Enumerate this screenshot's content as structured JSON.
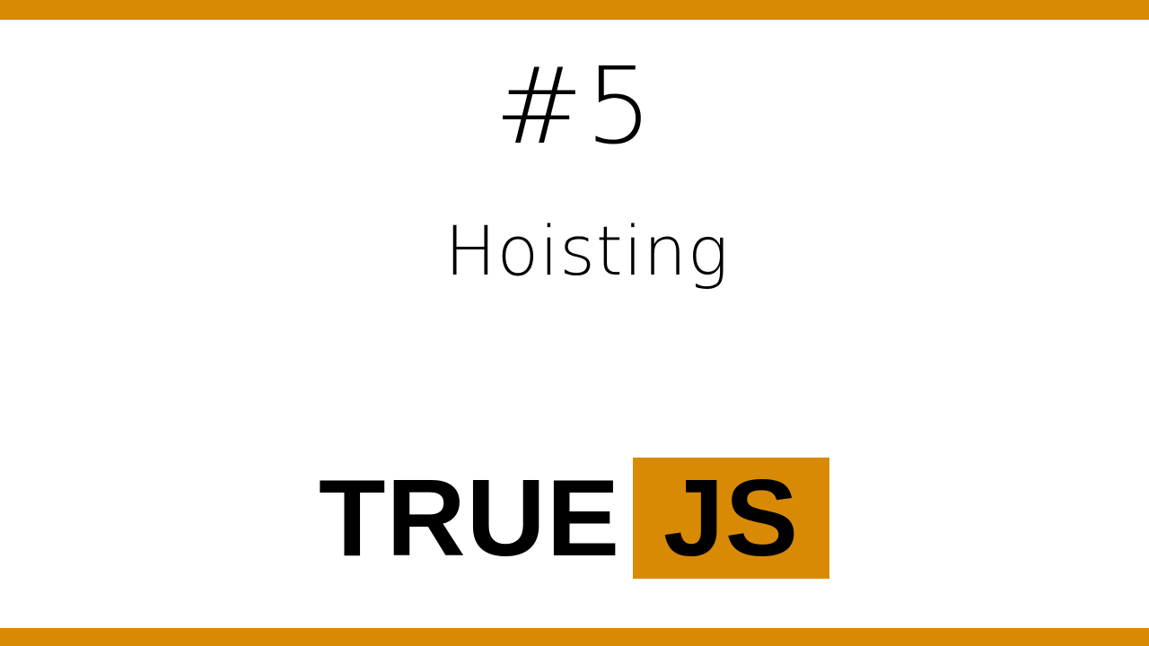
{
  "slide": {
    "episode_number": "#5",
    "episode_title": "Hoisting"
  },
  "logo": {
    "word_true": "TRUE",
    "word_js": "JS"
  },
  "colors": {
    "accent": "#D98A04",
    "text": "#000000",
    "background": "#FFFFFF"
  }
}
